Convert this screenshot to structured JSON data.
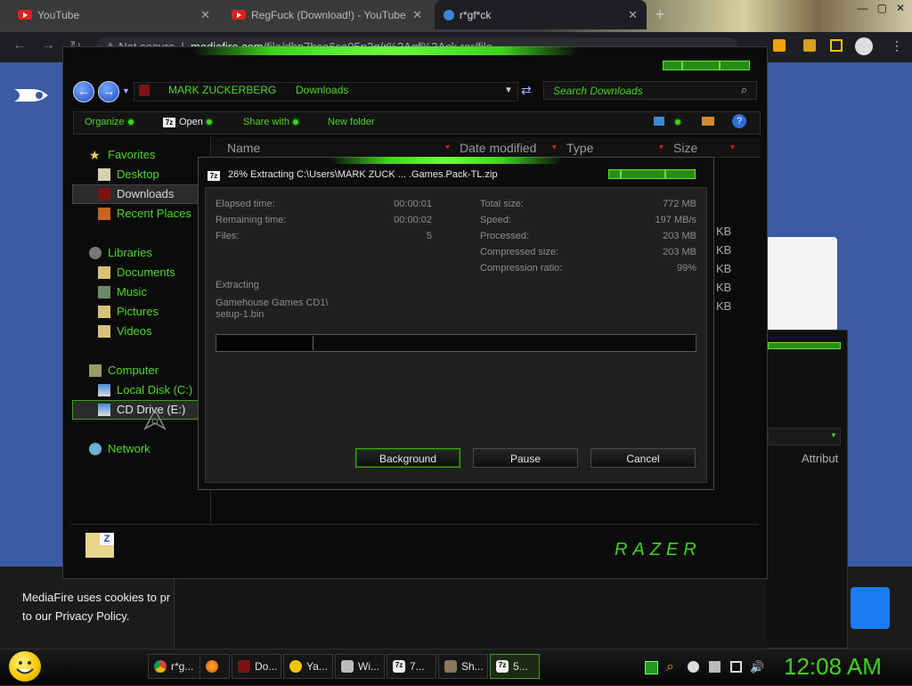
{
  "browser": {
    "tabs": [
      {
        "title": "YouTube",
        "icon": "youtube-icon",
        "active": false
      },
      {
        "title": "RegFuck (Download!) - YouTube",
        "icon": "youtube-icon",
        "active": false
      },
      {
        "title": "r*gf*ck",
        "icon": "mediafire-icon",
        "active": true
      }
    ],
    "address_prefix": "Not secure",
    "address_host": "mediafire.com",
    "address_path": "/file/dhn7hso6sa05p2q/r%2Agf%2Ack.rar/file"
  },
  "page": {
    "cookie_text": "MediaFire uses cookies to pr",
    "cookie_link": "to our Privacy Policy."
  },
  "explorer": {
    "breadcrumbs": [
      "MARK ZUCKERBERG",
      "Downloads"
    ],
    "search_placeholder": "Search Downloads",
    "commands": [
      "Organize",
      "Open",
      "Share with",
      "New folder"
    ],
    "nav": {
      "favorites": "Favorites",
      "favorite_items": [
        "Desktop",
        "Downloads",
        "Recent Places"
      ],
      "libraries": "Libraries",
      "library_items": [
        "Documents",
        "Music",
        "Pictures",
        "Videos"
      ],
      "computer": "Computer",
      "computer_items": [
        "Local Disk (C:)",
        "CD Drive (E:)"
      ],
      "network": "Network"
    },
    "columns": [
      "Name",
      "Date modified",
      "Type",
      "Size"
    ],
    "size_cells": [
      "KB",
      "KB",
      "KB",
      "KB",
      "KB"
    ],
    "brand": "RAZER"
  },
  "dialog": {
    "title": "26% Extracting C:\\Users\\MARK ZUCK ... .Games.Pack-TL.zip",
    "left_stats": [
      {
        "label": "Elapsed time:",
        "value": "00:00:01"
      },
      {
        "label": "Remaining time:",
        "value": "00:00:02"
      },
      {
        "label": "Files:",
        "value": "5"
      }
    ],
    "right_stats": [
      {
        "label": "Total size:",
        "value": "772 MB"
      },
      {
        "label": "Speed:",
        "value": "197 MB/s"
      },
      {
        "label": "Processed:",
        "value": "203 MB"
      },
      {
        "label": "Compressed size:",
        "value": "203 MB"
      },
      {
        "label": "Compression ratio:",
        "value": "99%"
      }
    ],
    "action": "Extracting",
    "path_line1": "Gamehouse Games CD1\\",
    "path_line2": "setup-1.bin",
    "progress": 0.2,
    "buttons": [
      "Background",
      "Pause",
      "Cancel"
    ]
  },
  "background_window": {
    "column": "Attribut"
  },
  "taskbar": {
    "buttons": [
      {
        "label": "r*g...",
        "icon": "chrome-icon",
        "active": false
      },
      {
        "label": "",
        "icon": "firefox-icon",
        "active": false
      },
      {
        "label": "Do...",
        "icon": "folder-icon",
        "active": false
      },
      {
        "label": "Ya...",
        "icon": "yahoo-icon",
        "active": false
      },
      {
        "label": "Wi...",
        "icon": "window-icon",
        "active": false
      },
      {
        "label": "7...",
        "icon": "7zip-icon",
        "active": false
      },
      {
        "label": "Sh...",
        "icon": "shortcut-icon",
        "active": false
      },
      {
        "label": "5...",
        "icon": "7zip-icon",
        "active": true
      }
    ],
    "clock": "12:08 AM"
  },
  "colors": {
    "accent_green": "#3fd41c",
    "youtube_red": "#e02020",
    "mediafire_blue": "#3b5ba5"
  }
}
